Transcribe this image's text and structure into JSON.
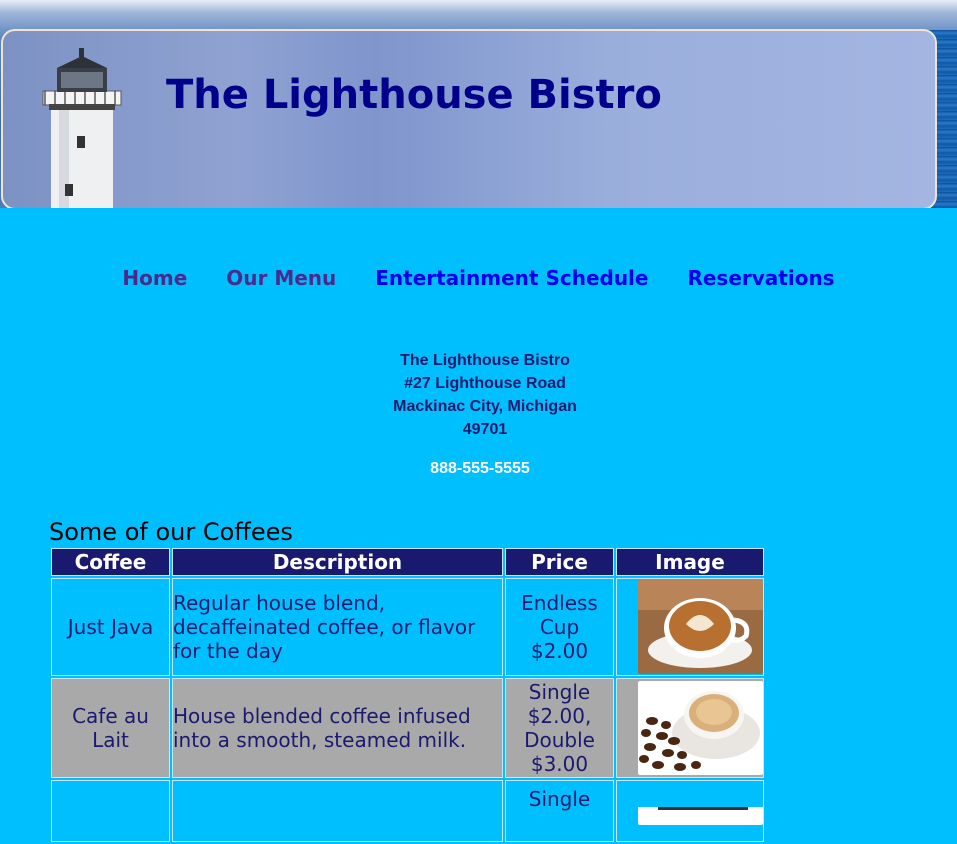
{
  "site": {
    "title": "The Lighthouse Bistro"
  },
  "nav": {
    "items": [
      {
        "label": "Home"
      },
      {
        "label": "Our Menu"
      },
      {
        "label": "Entertainment Schedule"
      },
      {
        "label": "Reservations"
      }
    ]
  },
  "address": {
    "name": "The Lighthouse Bistro",
    "street": "#27 Lighthouse Road",
    "city": "Mackinac City, Michigan",
    "zip": "49701",
    "phone": "888-555-5555"
  },
  "coffees": {
    "caption": "Some of our Coffees",
    "headers": [
      "Coffee",
      "Description",
      "Price",
      "Image"
    ],
    "rows": [
      {
        "coffee": "Just Java",
        "description": "Regular house blend, decaffeinated coffee, or flavor for the day",
        "price": [
          "Endless",
          "Cup",
          "$2.00"
        ]
      },
      {
        "coffee": "Cafe au Lait",
        "description": "House blended coffee infused into a smooth, steamed milk.",
        "price": [
          "Single",
          "$2.00,",
          "Double",
          "$3.00"
        ]
      },
      {
        "coffee": "",
        "description": "",
        "price": [
          "Single"
        ]
      }
    ]
  },
  "colors": {
    "page_background": "#00bfff",
    "title": "#00008b",
    "table_header": "#191970",
    "alt_row": "#a9a9a9"
  }
}
